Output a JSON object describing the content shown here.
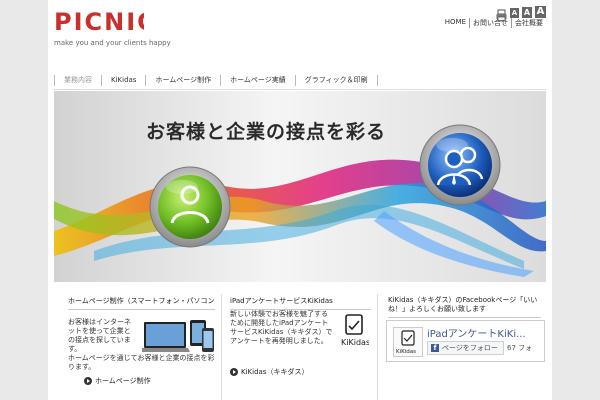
{
  "header": {
    "logo_text": "PICNIC",
    "tagline": "make you and your clients happy",
    "font_size_controls": [
      "A",
      "A",
      "A"
    ],
    "util_nav": [
      "HOME",
      "お問い合せ",
      "会社概要"
    ]
  },
  "nav": {
    "items": [
      "業務内容",
      "KiKidas",
      "ホームページ制作",
      "ホームページ実績",
      "グラフィック＆印刷"
    ]
  },
  "hero": {
    "title": "お客様と企業の接点を彩る"
  },
  "panels": {
    "web": {
      "title": "ホームページ制作（スマートフォン・パソコン）",
      "text_wrapped": "お客様はインターネットを使って企業との接点を探しています。",
      "text_full": "ホームページを通じてお客様と企業の接点を彩ります。",
      "more_label": "ホームページ制作"
    },
    "ipad": {
      "title": "iPadアンケートサービスKiKidas",
      "text": "新しい体験でお客様を魅了するために開発したiPadアンケートサービスKiKidas（キキダス）でアンケートを再発明しました。",
      "logo_text": "KiKidas",
      "more_label": "KiKidas（キキダス）"
    },
    "facebook": {
      "title": "KiKidas（キキダス）のFacebookページ「いいね！」よろしくお願い致します",
      "page_name": "iPadアンケートKiKi...",
      "thumb_text": "KiKidas",
      "follow_label": "ページをフォロー",
      "count": "67 フォ"
    }
  },
  "colors": {
    "brand_red": "#c9302c",
    "green_icon": "#6dbb23",
    "blue_icon": "#1f5fbf",
    "facebook_blue": "#3b5998"
  }
}
